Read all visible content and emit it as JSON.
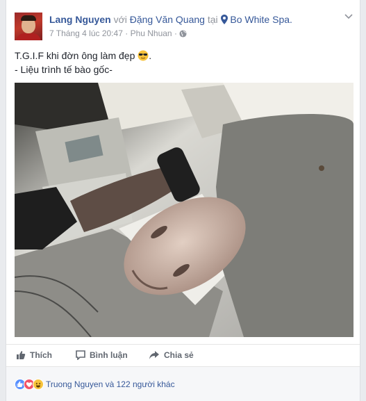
{
  "post": {
    "author": "Lang Nguyen",
    "with_word": "với",
    "tagged": "Đặng Văn Quang",
    "at_word": "tại",
    "place": "Bo White Spa.",
    "timestamp": "7 Tháng 4 lúc 20:47",
    "separator": "·",
    "location": "Phu Nhuan",
    "separator2": "·",
    "text_line1": "T.G.I.F khi đờn ông làm đẹp",
    "text_line1_end": ".",
    "text_line2": "- Liệu trình tế bào gốc-"
  },
  "actions": {
    "like": "Thích",
    "comment": "Bình luận",
    "share": "Chia sẻ"
  },
  "reactions": {
    "summary": "Truong Nguyen và 122 người khác",
    "icons": [
      "like-icon",
      "love-icon",
      "haha-icon"
    ]
  },
  "colors": {
    "link": "#365899",
    "muted": "#90949c",
    "background": "#e9ebee"
  }
}
